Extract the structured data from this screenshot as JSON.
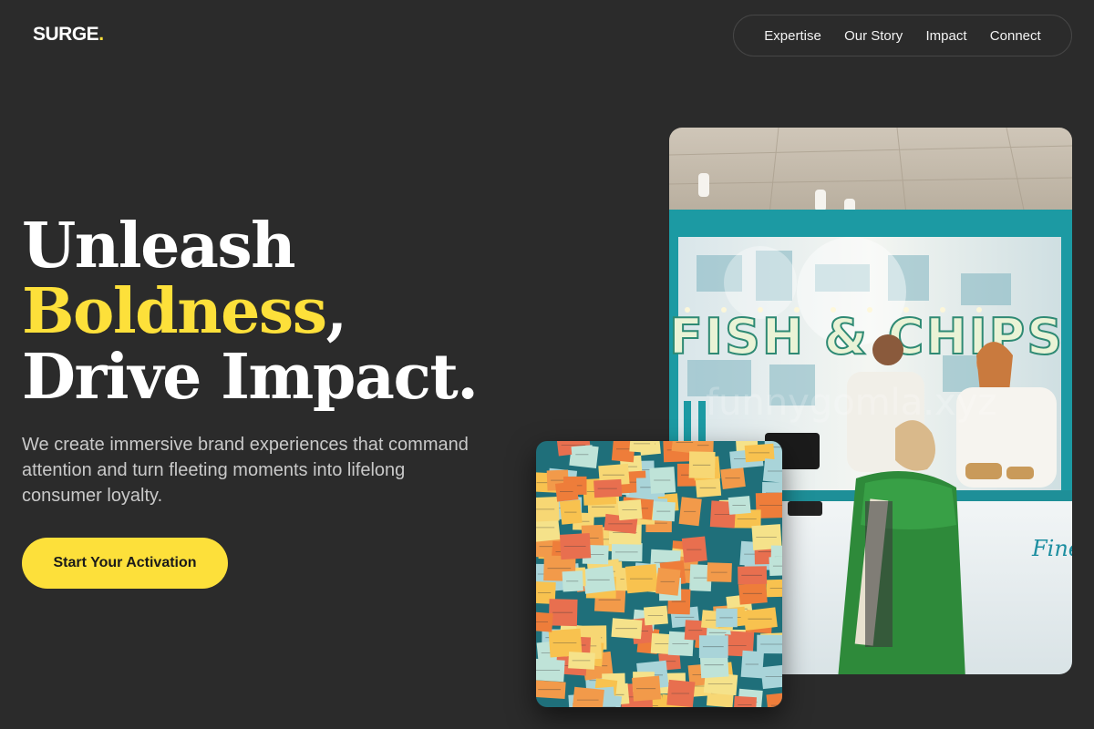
{
  "header": {
    "logo_text": "SURGE",
    "logo_dot": ".",
    "nav": [
      {
        "label": "Expertise"
      },
      {
        "label": "Our Story"
      },
      {
        "label": "Impact"
      },
      {
        "label": "Connect"
      }
    ]
  },
  "hero": {
    "headline_line1": "Unleash",
    "headline_accent": "Boldness",
    "headline_comma": ",",
    "headline_line3": "Drive Impact.",
    "subtext": "We create immersive brand experiences that command attention and turn fleeting moments into lifelong consumer loyalty.",
    "cta_label": "Start Your Activation"
  },
  "images": {
    "main_sign_text": "FISH & CHIPS",
    "main_counter_text": "Fine",
    "watermark": "funnygomla.xyz"
  },
  "colors": {
    "background": "#2b2b2b",
    "accent": "#fde03a",
    "text": "#ffffff",
    "muted_text": "#c9c9c9",
    "nav_border": "#464646"
  }
}
